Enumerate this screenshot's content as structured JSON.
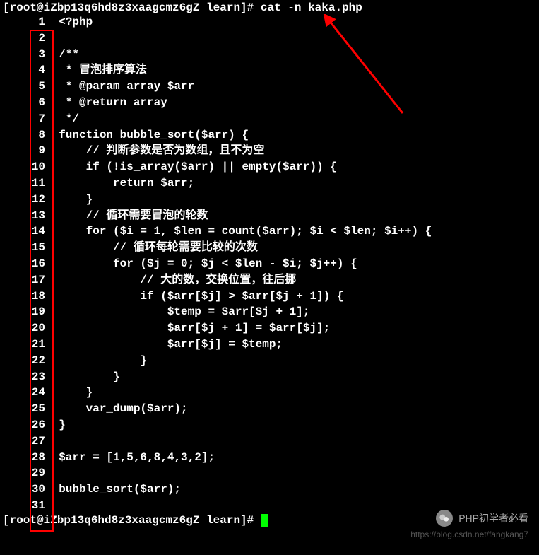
{
  "prompt1": "[root@iZbp13q6hd8z3xaagcmz6gZ learn]# cat -n kaka.php",
  "prompt2": "[root@iZbp13q6hd8z3xaagcmz6gZ learn]# ",
  "lines": [
    {
      "n": "1",
      "c": "<?php"
    },
    {
      "n": "2",
      "c": ""
    },
    {
      "n": "3",
      "c": "/**"
    },
    {
      "n": "4",
      "c": " * 冒泡排序算法"
    },
    {
      "n": "5",
      "c": " * @param array $arr"
    },
    {
      "n": "6",
      "c": " * @return array"
    },
    {
      "n": "7",
      "c": " */"
    },
    {
      "n": "8",
      "c": "function bubble_sort($arr) {"
    },
    {
      "n": "9",
      "c": "    // 判断参数是否为数组，且不为空"
    },
    {
      "n": "10",
      "c": "    if (!is_array($arr) || empty($arr)) {"
    },
    {
      "n": "11",
      "c": "        return $arr;"
    },
    {
      "n": "12",
      "c": "    }"
    },
    {
      "n": "13",
      "c": "    // 循环需要冒泡的轮数"
    },
    {
      "n": "14",
      "c": "    for ($i = 1, $len = count($arr); $i < $len; $i++) {"
    },
    {
      "n": "15",
      "c": "        // 循环每轮需要比较的次数"
    },
    {
      "n": "16",
      "c": "        for ($j = 0; $j < $len - $i; $j++) {"
    },
    {
      "n": "17",
      "c": "            // 大的数，交换位置，往后挪"
    },
    {
      "n": "18",
      "c": "            if ($arr[$j] > $arr[$j + 1]) {"
    },
    {
      "n": "19",
      "c": "                $temp = $arr[$j + 1];"
    },
    {
      "n": "20",
      "c": "                $arr[$j + 1] = $arr[$j];"
    },
    {
      "n": "21",
      "c": "                $arr[$j] = $temp;"
    },
    {
      "n": "22",
      "c": "            }"
    },
    {
      "n": "23",
      "c": "        }"
    },
    {
      "n": "24",
      "c": "    }"
    },
    {
      "n": "25",
      "c": "    var_dump($arr);"
    },
    {
      "n": "26",
      "c": "}"
    },
    {
      "n": "27",
      "c": ""
    },
    {
      "n": "28",
      "c": "$arr = [1,5,6,8,4,3,2];"
    },
    {
      "n": "29",
      "c": ""
    },
    {
      "n": "30",
      "c": "bubble_sort($arr);"
    },
    {
      "n": "31",
      "c": ""
    }
  ],
  "wechat_text": "PHP初学者必看",
  "watermark_text": "https://blog.csdn.net/fangkang7"
}
